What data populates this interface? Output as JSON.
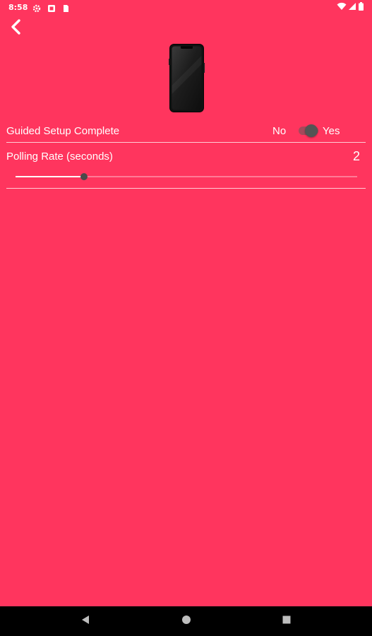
{
  "status_bar": {
    "time": "8:58",
    "icons_left": [
      "gear-icon",
      "screenshot-icon",
      "sim-card-icon"
    ],
    "icons_right": [
      "wifi-icon",
      "signal-icon",
      "battery-icon"
    ]
  },
  "toolbar": {
    "back_icon": "chevron-left-icon"
  },
  "device_image": "phone-icon",
  "settings": {
    "guided_setup": {
      "label": "Guided Setup Complete",
      "off_label": "No",
      "on_label": "Yes",
      "value": true
    },
    "polling_rate": {
      "label": "Polling Rate (seconds)",
      "value": "2",
      "slider_fraction": 0.2
    }
  },
  "nav_bar": {
    "items": [
      "back-triangle-icon",
      "home-circle-icon",
      "recents-square-icon"
    ]
  },
  "colors": {
    "background": "#ff355e",
    "nav_bar": "#000000",
    "switch_thumb": "#545454"
  }
}
